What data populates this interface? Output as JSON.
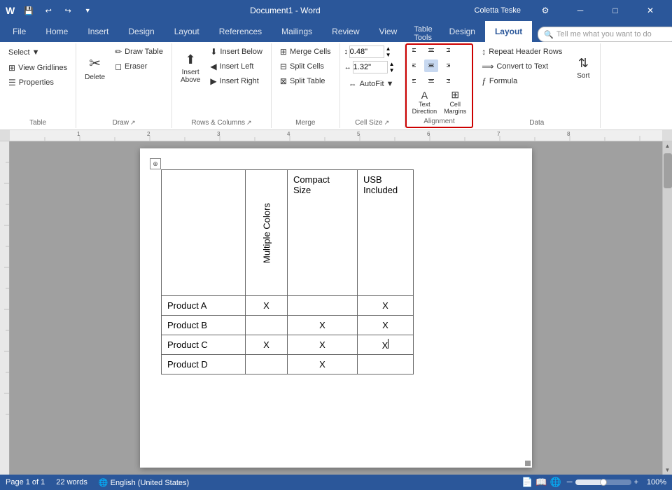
{
  "titleBar": {
    "title": "Document1 - Word",
    "minBtn": "─",
    "maxBtn": "□",
    "closeBtn": "✕",
    "quickAccess": [
      "💾",
      "↩",
      "↪",
      "▼"
    ]
  },
  "tabBar": {
    "tableToolsLabel": "Table Tools",
    "tabs": [
      "File",
      "Home",
      "Insert",
      "Design",
      "Layout",
      "References",
      "Mailings",
      "Review",
      "View",
      "Design",
      "Layout"
    ],
    "activeTabs": [
      "Layout"
    ],
    "contextTabs": [
      "Design",
      "Layout"
    ]
  },
  "ribbon": {
    "groups": {
      "table": {
        "label": "Table",
        "select": "Select ▼",
        "viewGridlines": "View Gridlines",
        "properties": "Properties"
      },
      "draw": {
        "label": "Draw",
        "drawTable": "Draw Table",
        "eraser": "Eraser",
        "delete": "Delete"
      },
      "rowsColumns": {
        "label": "Rows & Columns",
        "insertBelow": "Insert Below",
        "insertLeft": "Insert Left",
        "insertRight": "Insert Right",
        "insertAbove": "Insert Above"
      },
      "merge": {
        "label": "Merge",
        "mergeCells": "Merge Cells",
        "splitCells": "Split Cells",
        "splitTable": "Split Table"
      },
      "cellSize": {
        "label": "Cell Size",
        "height": "0.48\"",
        "width": "1.32\"",
        "autoFit": "AutoFit"
      },
      "alignment": {
        "label": "Alignment",
        "textDirection": "Text Direction",
        "cellMargins": "Cell Margins",
        "alignButtons": [
          "↖",
          "↑",
          "↗",
          "←",
          "·",
          "→",
          "↙",
          "↓",
          "↘"
        ]
      },
      "data": {
        "label": "Data",
        "repeatHeaderRows": "Repeat Header Rows",
        "convertToText": "Convert to Text",
        "sort": "Sort",
        "formula": "Formula"
      }
    }
  },
  "document": {
    "table": {
      "headers": [
        "",
        "Multiple Colors",
        "Compact Size",
        "USB Included"
      ],
      "rows": [
        {
          "product": "Product A",
          "multipleColors": "X",
          "compactSize": "",
          "usbIncluded": "X"
        },
        {
          "product": "Product B",
          "multipleColors": "",
          "compactSize": "X",
          "usbIncluded": "X"
        },
        {
          "product": "Product C",
          "multipleColors": "X",
          "compactSize": "X",
          "usbIncluded": "X"
        },
        {
          "product": "Product D",
          "multipleColors": "",
          "compactSize": "X",
          "usbIncluded": ""
        }
      ]
    }
  },
  "statusBar": {
    "pageInfo": "Page 1 of 1",
    "wordCount": "22 words",
    "zoom": "100%"
  },
  "user": "Coletta Teske",
  "tellMe": "Tell me what you want to do"
}
